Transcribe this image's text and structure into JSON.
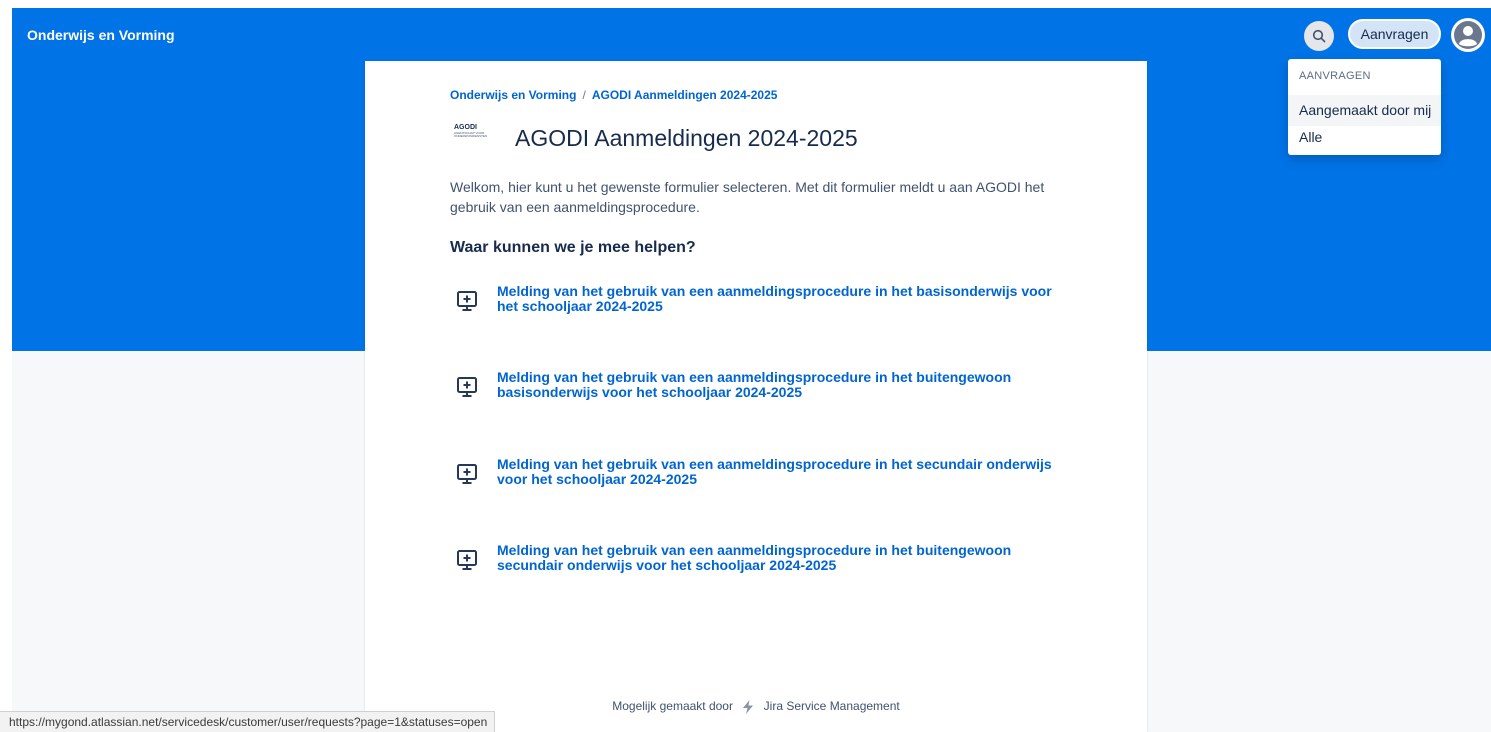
{
  "header": {
    "brand": "Onderwijs en Vorming",
    "search_icon": "search-icon",
    "requests_label": "Aanvragen",
    "avatar_icon": "user-avatar-icon",
    "banner_color": "#0073e6"
  },
  "requests_menu": {
    "heading": "AANVRAGEN",
    "items": [
      {
        "label": "Aangemaakt door mij"
      },
      {
        "label": "Alle"
      }
    ]
  },
  "breadcrumb": {
    "items": [
      "Onderwijs en Vorming",
      "AGODI Aanmeldingen 2024-2025"
    ],
    "separator": "/"
  },
  "portal": {
    "logo_text": "AGODI",
    "logo_subtext": "AGENTSCHAP VOOR ONDERWIJSDIENSTEN",
    "title": "AGODI Aanmeldingen 2024-2025",
    "intro": "Welkom, hier kunt u het gewenste formulier selecteren. Met dit formulier meldt u aan AGODI het gebruik van een aanmeldingsprocedure.",
    "help_heading": "Waar kunnen we je mee helpen?"
  },
  "request_types": [
    {
      "label": "Melding van het gebruik van een aanmeldingsprocedure in het basisonderwijs voor het schooljaar 2024-2025",
      "icon": "monitor-plus-icon"
    },
    {
      "label": "Melding van het gebruik van een aanmeldingsprocedure in het buitengewoon basisonderwijs voor het schooljaar 2024-2025",
      "icon": "monitor-plus-icon"
    },
    {
      "label": "Melding van het gebruik van een aanmeldingsprocedure in het secundair onderwijs voor het schooljaar 2024-2025",
      "icon": "monitor-plus-icon"
    },
    {
      "label": "Melding van het gebruik van een aanmeldingsprocedure in het buitengewoon secundair onderwijs voor het schooljaar 2024-2025",
      "icon": "monitor-plus-icon"
    }
  ],
  "footer": {
    "prefix": "Mogelijk gemaakt door",
    "product": "Jira Service Management",
    "icon": "jira-bolt-icon"
  },
  "status_bar": {
    "url": "https://mygond.atlassian.net/servicedesk/customer/user/requests?page=1&statuses=open"
  }
}
